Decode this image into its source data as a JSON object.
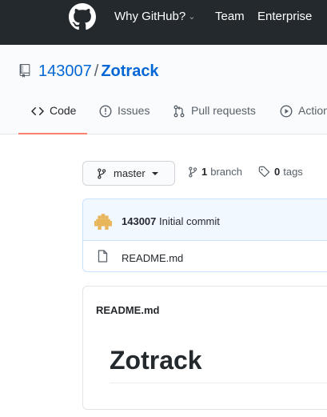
{
  "header": {
    "logo_icon": "github-octocat-icon",
    "nav": {
      "why": "Why GitHub?",
      "team": "Team",
      "enterprise": "Enterprise"
    }
  },
  "repo": {
    "icon": "repo-icon",
    "owner": "143007",
    "separator": "/",
    "name": "Zotrack"
  },
  "tabs": [
    {
      "label": "Code",
      "icon": "code-icon",
      "selected": true
    },
    {
      "label": "Issues",
      "icon": "issue-opened-icon"
    },
    {
      "label": "Pull requests",
      "icon": "git-pull-request-icon"
    },
    {
      "label": "Actions",
      "icon": "play-icon"
    }
  ],
  "branch_bar": {
    "branch_name": "master",
    "branch_count": "1",
    "branch_label": "branch",
    "tag_count": "0",
    "tag_label": "tags"
  },
  "commit": {
    "author": "143007",
    "message": "Initial commit"
  },
  "files": [
    {
      "name": "README.md",
      "icon": "file-icon"
    }
  ],
  "readme": {
    "header": "README.md",
    "title": "Zotrack"
  },
  "colors": {
    "header_bg": "#24292e",
    "link": "#0366d6",
    "tab_underline": "#f9826c",
    "commit_bg": "#f1f8ff"
  }
}
